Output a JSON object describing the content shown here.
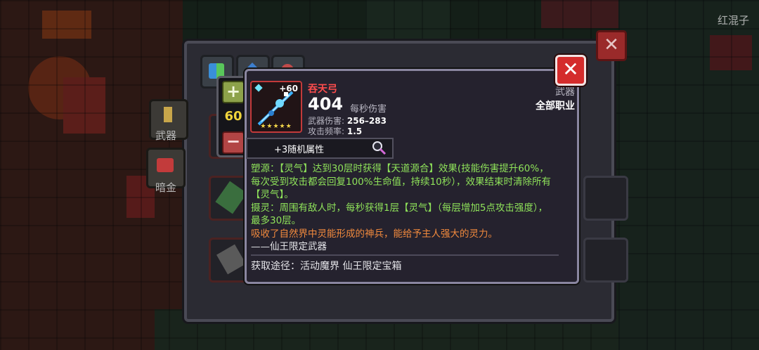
{
  "watermark": "红混子",
  "sidebar": {
    "weapon_label": "武器",
    "dark_gold_label": "暗金"
  },
  "level": {
    "value": "60",
    "increase_symbol": "+",
    "decrease_symbol": "−"
  },
  "item": {
    "name": "吞天弓",
    "upgrade": "+60",
    "stars": "★★★★★",
    "dps": "404",
    "dps_label": "每秒伤害",
    "damage_label": "武器伤害:",
    "damage_value": "256–283",
    "rate_label": "攻击频率:",
    "rate_value": "1.5",
    "type": "武器",
    "class": "全部职业",
    "random_attr": "+3随机属性",
    "effect_lines": [
      "塑源：【灵气】达到30层时获得【天道源合】效果(技能伤害提升60%，每次受到攻击都会回复100%生命值，持续10秒），效果结束时清除所有【灵气】。",
      "摄灵：周围有敌人时，每秒获得1层【灵气】（每层增加5点攻击强度），最多30层。"
    ],
    "lore": "吸收了自然界中灵能形成的神兵，能给予主人强大的灵力。",
    "lore_sign": "——仙王限定武器",
    "source": "获取途径：活动魔界 仙王限定宝箱"
  },
  "buttons": {
    "close": "✕"
  },
  "colors": {
    "name_red": "#ff4d4d",
    "effect_green": "#8fe35a",
    "lore_orange": "#f28a3d",
    "level_yellow": "#f0d43c"
  }
}
